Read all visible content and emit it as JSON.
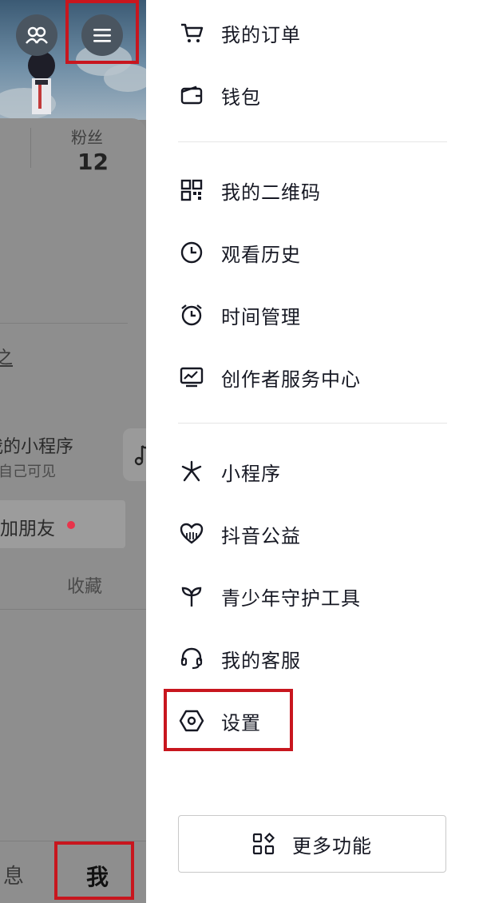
{
  "profile": {
    "followers_label": "粉丝",
    "followers_count": "12",
    "partial_text_1": "之",
    "mini_program_title": "我的小程序",
    "mini_program_sub": "仅自己可见",
    "add_friends_label": "加朋友",
    "favorites_tab": "收藏",
    "bottom_nav_messages": "息",
    "bottom_nav_me": "我"
  },
  "drawer": {
    "group1": [
      {
        "icon": "cart-icon",
        "label": "我的订单"
      },
      {
        "icon": "wallet-icon",
        "label": "钱包"
      }
    ],
    "group2": [
      {
        "icon": "qr-code-icon",
        "label": "我的二维码"
      },
      {
        "icon": "clock-icon",
        "label": "观看历史"
      },
      {
        "icon": "alarm-clock-icon",
        "label": "时间管理"
      },
      {
        "icon": "chart-monitor-icon",
        "label": "创作者服务中心"
      }
    ],
    "group3": [
      {
        "icon": "mini-program-icon",
        "label": "小程序"
      },
      {
        "icon": "heart-charity-icon",
        "label": "抖音公益"
      },
      {
        "icon": "sprout-icon",
        "label": "青少年守护工具"
      },
      {
        "icon": "headset-icon",
        "label": "我的客服"
      },
      {
        "icon": "settings-hexagon-icon",
        "label": "设置"
      }
    ],
    "more_button": {
      "icon": "grid-apps-icon",
      "label": "更多功能"
    }
  },
  "colors": {
    "highlight_border": "#c8161e",
    "notification_dot": "#e8344b",
    "text_primary": "#161823",
    "overlay": "#8a8a8a"
  }
}
